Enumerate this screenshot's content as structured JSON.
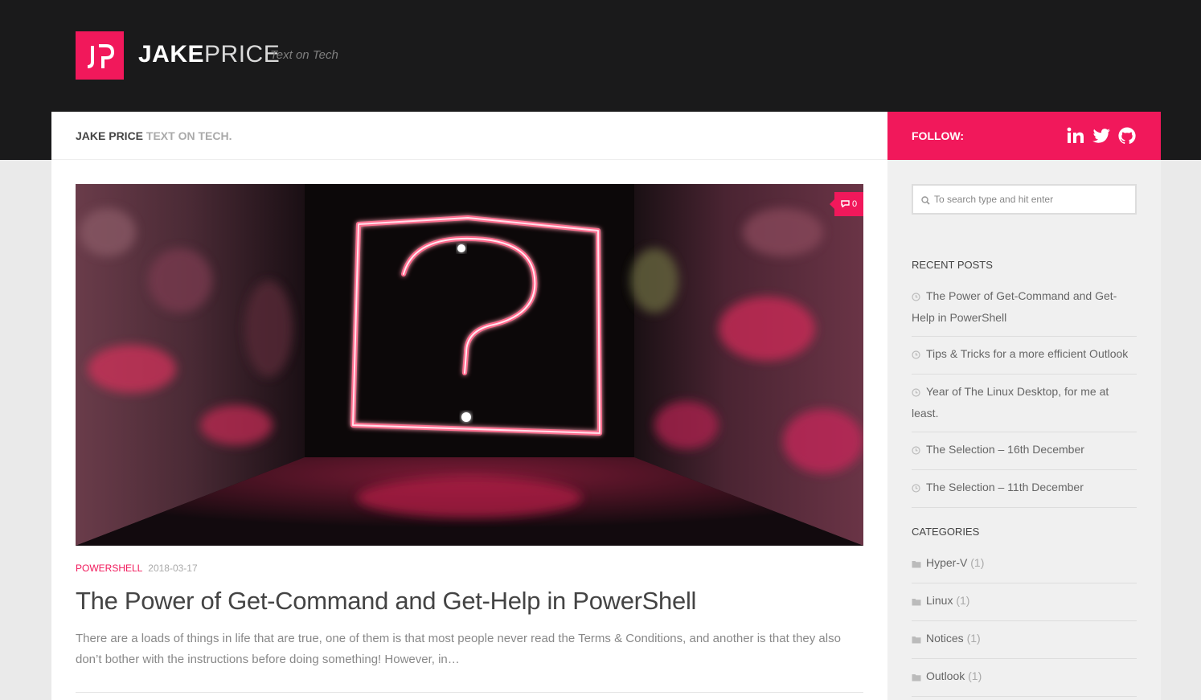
{
  "header": {
    "logo_text": "JP",
    "site_name_bold": "JAKE",
    "site_name_light": "PRICE",
    "tagline": "Text on Tech"
  },
  "page_title": {
    "main": "JAKE PRICE",
    "sub": "TEXT ON TECH."
  },
  "follow": {
    "label": "FOLLOW:",
    "icons": [
      "linkedin-icon",
      "twitter-icon",
      "github-icon"
    ]
  },
  "search": {
    "placeholder": "To search type and hit enter",
    "value": ""
  },
  "recent_posts": {
    "title": "RECENT POSTS",
    "items": [
      {
        "label": "The Power of Get-Command and Get-Help in PowerShell"
      },
      {
        "label": "Tips & Tricks for a more efficient Outlook"
      },
      {
        "label": "Year of The Linux Desktop, for me at least."
      },
      {
        "label": "The Selection – 16th December"
      },
      {
        "label": "The Selection – 11th December"
      }
    ]
  },
  "categories": {
    "title": "CATEGORIES",
    "items": [
      {
        "label": "Hyper-V",
        "count": "(1)"
      },
      {
        "label": "Linux",
        "count": "(1)"
      },
      {
        "label": "Notices",
        "count": "(1)"
      },
      {
        "label": "Outlook",
        "count": "(1)"
      }
    ]
  },
  "post": {
    "comment_count": "0",
    "category": "POWERSHELL",
    "date": "2018-03-17",
    "title": "The Power of Get-Command and Get-Help in PowerShell",
    "excerpt": "There are a loads of things in life that are true, one of them is that most people never read the Terms & Conditions, and another is that they also don’t bother with the instructions before doing something! However, in…"
  },
  "colors": {
    "accent": "#f1185b",
    "header_bg": "#1a1a1b",
    "page_bg": "#eaeaea",
    "sidebar_bg": "#f0f0f0"
  }
}
